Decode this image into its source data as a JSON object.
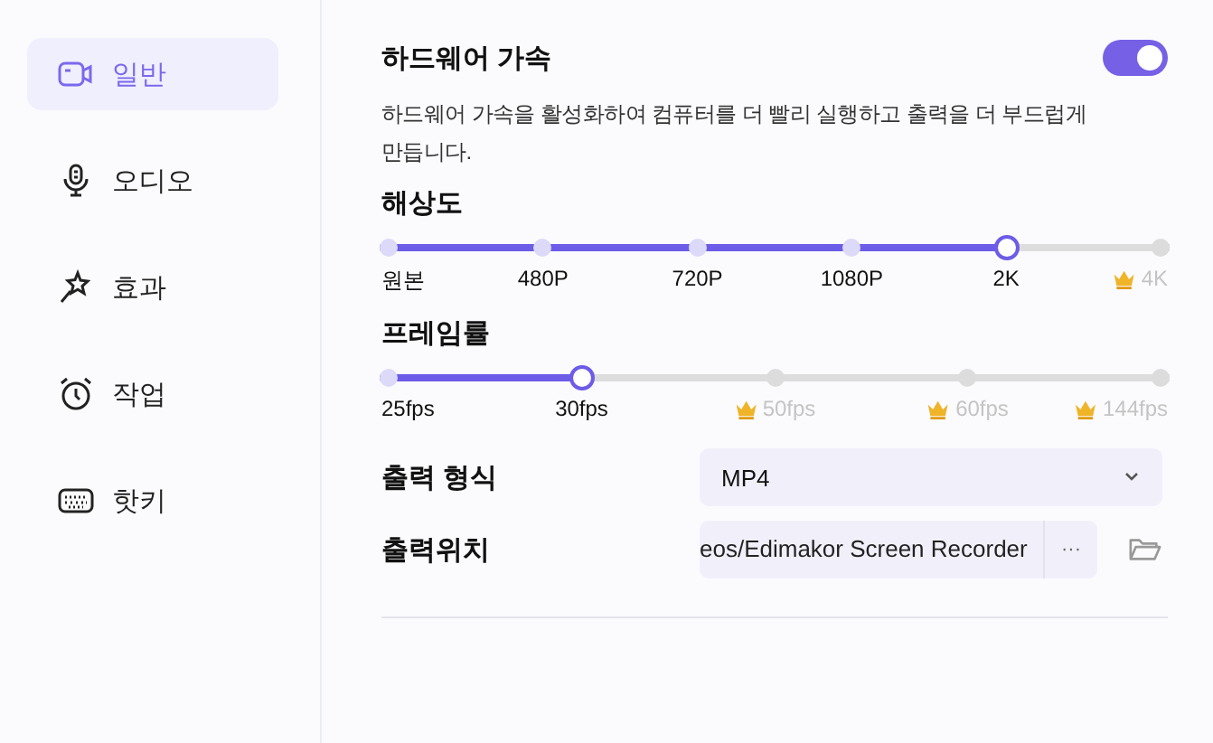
{
  "sidebar": {
    "items": [
      {
        "label": "일반",
        "selected": true
      },
      {
        "label": "오디오",
        "selected": false
      },
      {
        "label": "효과",
        "selected": false
      },
      {
        "label": "작업",
        "selected": false
      },
      {
        "label": "핫키",
        "selected": false
      }
    ]
  },
  "hardware_acceleration": {
    "title": "하드웨어 가속",
    "on": true,
    "description": "하드웨어 가속을 활성화하여 컴퓨터를 더 빨리 실행하고 출력을 더 부드럽게 만듭니다."
  },
  "sliders": [
    {
      "title": "해상도",
      "level": 0.8,
      "stops": [
        {
          "label": "원본",
          "locked": false
        },
        {
          "label": "480P",
          "locked": false
        },
        {
          "label": "720P",
          "locked": false
        },
        {
          "label": "1080P",
          "locked": false
        },
        {
          "label": "2K",
          "locked": false
        },
        {
          "label": "4K",
          "locked": true
        }
      ]
    },
    {
      "title": "프레임률",
      "level": 0.25,
      "stops": [
        {
          "label": "25fps",
          "locked": false
        },
        {
          "label": "30fps",
          "locked": false
        },
        {
          "label": "50fps",
          "locked": true
        },
        {
          "label": "60fps",
          "locked": true
        },
        {
          "label": "144fps",
          "locked": true
        }
      ]
    }
  ],
  "output_format": {
    "label": "출력 형식",
    "value": "MP4"
  },
  "output_location": {
    "label": "출력위치",
    "value": "eos/Edimakor Screen Recorder",
    "browse": "···"
  }
}
